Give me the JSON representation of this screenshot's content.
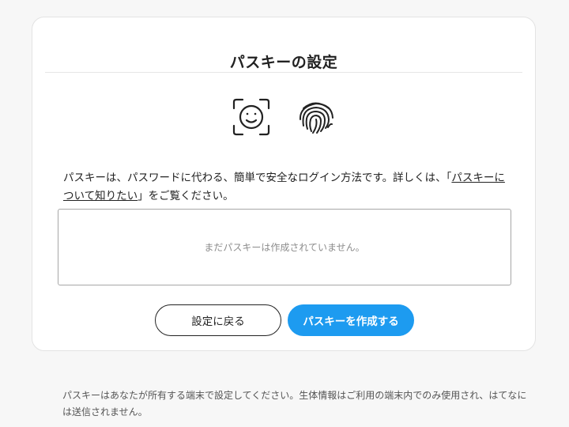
{
  "card": {
    "title": "パスキーの設定",
    "icons": [
      "face-id-icon",
      "fingerprint-icon"
    ],
    "description_before": "パスキーは、パスワードに代わる、簡単で安全なログイン方法です。詳しくは、「",
    "description_link": "パスキーについて知りたい",
    "description_after": "」をご覧ください。",
    "empty_state": "まだパスキーは作成されていません。",
    "back_button_label": "設定に戻る",
    "create_button_label": "パスキーを作成する"
  },
  "footer": {
    "note": "パスキーはあなたが所有する端末で設定してください。生体情報はご利用の端末内でのみ使用され、はてなには送信されません。"
  },
  "colors": {
    "accent": "#1d9bf0",
    "background": "#f7f7f7",
    "card": "#ffffff"
  }
}
